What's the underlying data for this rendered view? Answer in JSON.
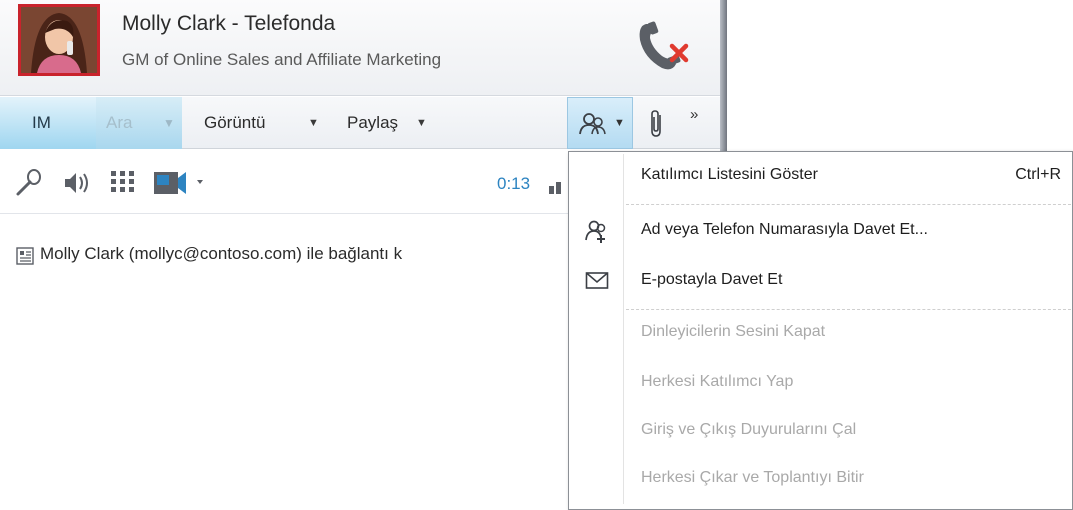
{
  "header": {
    "contact_name": "Molly Clark - Telefonda",
    "contact_title": "GM of Online Sales and Affiliate Marketing"
  },
  "tabs": {
    "im": "IM",
    "ara": "Ara",
    "goruntu": "Görüntü",
    "paylas": "Paylaş",
    "more": "»",
    "dropdown_arrow": "▼"
  },
  "audio": {
    "timer": "0:13"
  },
  "conversation": {
    "status_line": "Molly Clark (mollyc@contoso.com) ile bağlantı k"
  },
  "menu": {
    "items": [
      {
        "label": "Katılımcı Listesini Göster",
        "shortcut": "Ctrl+R",
        "enabled": true
      },
      {
        "label": "Ad veya Telefon Numarasıyla Davet Et...",
        "enabled": true,
        "icon": "add-people-icon"
      },
      {
        "label": "E-postayla Davet Et",
        "enabled": true,
        "icon": "envelope-icon"
      },
      {
        "label": "Dinleyicilerin Sesini Kapat",
        "enabled": false
      },
      {
        "label": "Herkesi Katılımcı Yap",
        "enabled": false
      },
      {
        "label": "Giriş ve Çıkış Duyurularını Çal",
        "enabled": false
      },
      {
        "label": "Herkesi Çıkar ve Toplantıyı Bitir",
        "enabled": false
      }
    ]
  },
  "colors": {
    "accent_blue": "#2d84c1",
    "hangup_red": "#e03a2f",
    "avatar_border": "#c9232c"
  }
}
